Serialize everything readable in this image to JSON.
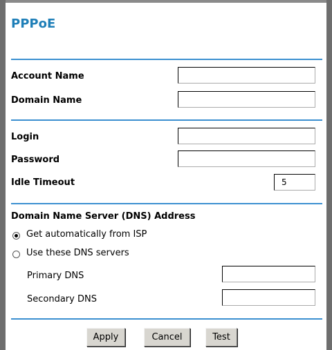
{
  "page": {
    "title": "PPPoE"
  },
  "account": {
    "account_name_label": "Account Name",
    "account_name_value": "",
    "domain_name_label": "Domain Name",
    "domain_name_value": ""
  },
  "auth": {
    "login_label": "Login",
    "login_value": "",
    "password_label": "Password",
    "password_value": "",
    "idle_timeout_label": "Idle Timeout",
    "idle_timeout_value": "5"
  },
  "dns": {
    "heading": "Domain Name Server (DNS) Address",
    "option_auto": "Get automatically from ISP",
    "option_manual": "Use these DNS servers",
    "selected": "auto",
    "primary_label": "Primary DNS",
    "primary_value": "",
    "secondary_label": "Secondary DNS",
    "secondary_value": ""
  },
  "buttons": {
    "apply": "Apply",
    "cancel": "Cancel",
    "test": "Test"
  },
  "colors": {
    "accent": "#3a8fd0",
    "title": "#1f7fb8",
    "frame": "#6e6e6e"
  }
}
